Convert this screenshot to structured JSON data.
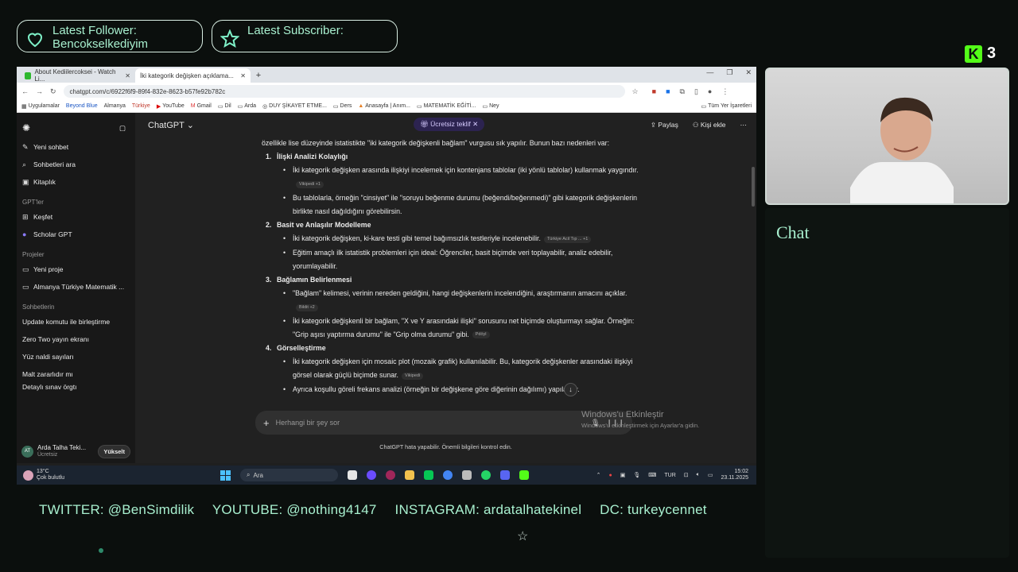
{
  "overlay": {
    "follower_label": "Latest Follower:",
    "follower_name": "Bencokselkediyim",
    "subscriber_label": "Latest Subscriber:",
    "kick_count": "3",
    "chat_label": "Chat",
    "socials": {
      "twitter": "TWITTER: @BenSimdilik",
      "youtube": "YOUTUBE: @nothing4147",
      "instagram": "INSTAGRAM: ardatalhatekinel",
      "discord": "DC: turkeycennet"
    }
  },
  "browser": {
    "tabs": [
      {
        "title": "About Kediilercoksei - Watch Li...",
        "active": false
      },
      {
        "title": "İki kategorik değişken açıklama...",
        "active": true
      }
    ],
    "url": "chatgpt.com/c/6922f6f9-89f4-832e-8623-b57fe92b782c",
    "bookmarks": [
      "Uygulamalar",
      "Beyond Blue",
      "Almanya",
      "Türkiye",
      "YouTube",
      "Gmail",
      "Dil",
      "Arda",
      "DUY ŞİKAYET ETME...",
      "Ders",
      "Anasayfa | Anım...",
      "MATEMATİK EĞİTİ...",
      "Ney"
    ],
    "bookmarks_right": "Tüm Yer İşaretleri"
  },
  "sidebar": {
    "items": [
      "Yeni sohbet",
      "Sohbetleri ara",
      "Kitaplık"
    ],
    "gpts_label": "GPT'ler",
    "gpts": [
      "Keşfet",
      "Scholar GPT"
    ],
    "projects_label": "Projeler",
    "projects": [
      "Yeni proje",
      "Almanya Türkiye Matematik ..."
    ],
    "chats_label": "Sohbetlerin",
    "chats": [
      "Update komutu ile birleştirme",
      "Zero Two yayın ekranı",
      "Yüz naldi sayıları",
      "Malt zararlıdır mı",
      "Detaylı sınav örgtı"
    ],
    "user_name": "Arda Talha Teki...",
    "user_plan": "Ücretsiz",
    "user_initials": "AT",
    "upgrade_label": "Yükselt"
  },
  "topbar": {
    "model": "ChatGPT",
    "offer": "Ücretsiz teklif",
    "share": "Paylaş",
    "add_people": "Kişi ekle"
  },
  "content": {
    "intro": "özellikle lise düzeyinde istatistikte \"iki kategorik değişkenli bağlam\" vurgusu sık yapılır. Bunun bazı nedenleri var:",
    "sections": [
      {
        "num": "1.",
        "title": "İlişki Analizi Kolaylığı",
        "bullets": [
          {
            "text": "İki kategorik değişken arasında ilişkiyi incelemek için kontenjans tablolar (iki yönlü tablolar) kullanmak yaygındır.",
            "cite": "Vikipedi +1"
          },
          {
            "text": "Bu tablolarla, örneğin \"cinsiyet\" ile \"soruyu beğenme durumu (beğendi/beğenmedi)\" gibi kategorik değişkenlerin birlikte nasıl dağıldığını görebilirsin.",
            "cite": ""
          }
        ]
      },
      {
        "num": "2.",
        "title": "Basit ve Anlaşılır Modelleme",
        "bullets": [
          {
            "text": "İki kategorik değişken, ki-kare testi gibi temel bağımsızlık testleriyle incelenebilir.",
            "cite": "Türkiye Acil Tıp ... +1"
          },
          {
            "text": "Eğitim amaçlı ilk istatistik problemleri için ideal: Öğrenciler, basit biçimde veri toplayabilir, analiz edebilir, yorumlayabilir.",
            "cite": ""
          }
        ]
      },
      {
        "num": "3.",
        "title": "Bağlamın Belirlenmesi",
        "bullets": [
          {
            "text": "\"Bağlam\" kelimesi, verinin nereden geldiğini, hangi değişkenlerin incelendiğini, araştırmanın amacını açıklar.",
            "cite": "Bildit +2"
          },
          {
            "text": "İki kategorik değişkenli bir bağlam, \"X ve Y arasındaki ilişki\" sorusunu net biçimde oluşturmayı sağlar. Örneğin: \"Grip aşısı yaptırma durumu\" ile \"Grip olma durumu\" gibi.",
            "cite": "Pdöyl"
          }
        ]
      },
      {
        "num": "4.",
        "title": "Görselleştirme",
        "bullets": [
          {
            "text": "İki kategorik değişken için mosaic plot (mozaik grafik) kullanılabilir. Bu, kategorik değişkenler arasındaki ilişkiyi görsel olarak güçlü biçimde sunar.",
            "cite": "Vikipedi"
          },
          {
            "text": "Ayrıca koşullu göreli frekans analizi (örneğin bir değişkene göre diğerinin dağılımı) yapılabilir.",
            "cite": ""
          }
        ]
      }
    ]
  },
  "composer": {
    "placeholder": "Herhangi bir şey sor",
    "watermark_title": "Windows'u Etkinleştir",
    "watermark_sub": "Windows'u etkinleştirmek için Ayarlar'a gidin.",
    "disclaimer": "ChatGPT hata yapabilir. Önemli bilgileri kontrol edin."
  },
  "taskbar": {
    "temp": "13°C",
    "weather": "Çok bulutlu",
    "search": "Ara",
    "lang": "TUR",
    "time": "15:02",
    "date": "23.11.2025"
  }
}
